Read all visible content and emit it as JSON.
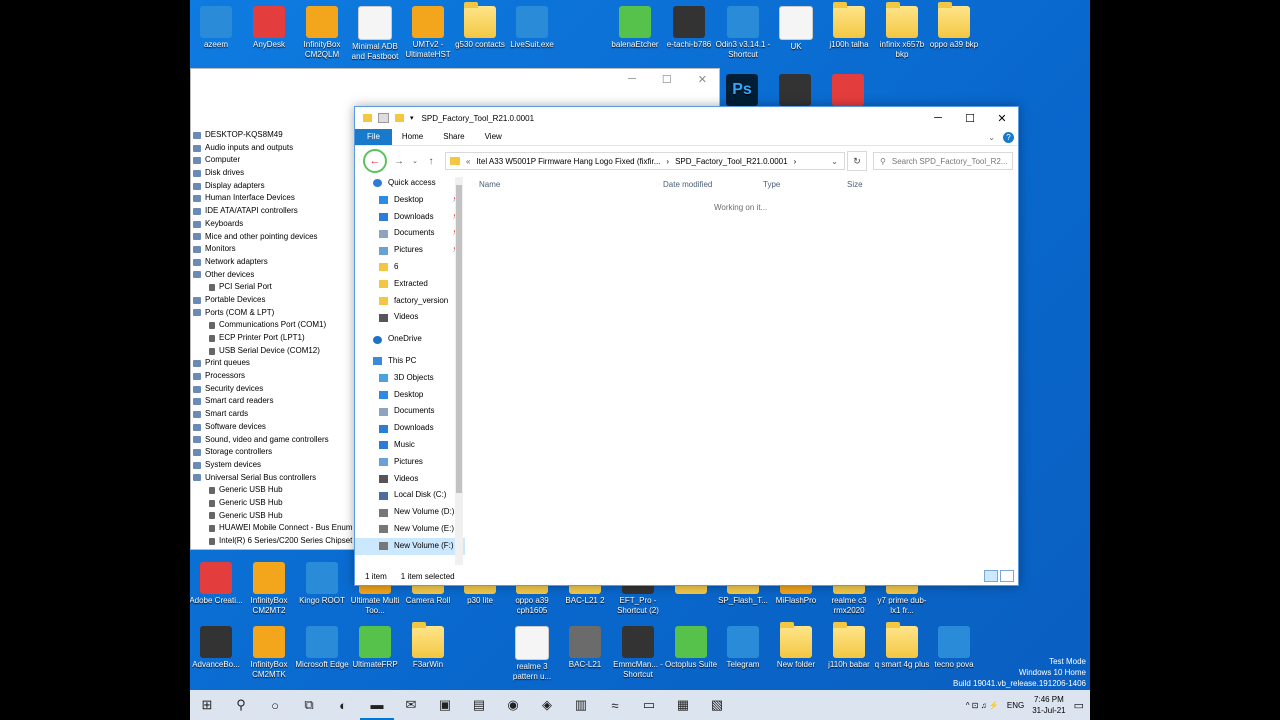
{
  "desktop": {
    "top_icons": [
      {
        "label": "azeem",
        "style": "app-blue"
      },
      {
        "label": "AnyDesk",
        "style": "app-red"
      },
      {
        "label": "InfinityBox CM2QLM",
        "style": "app-orange"
      },
      {
        "label": "Minimal ADB and Fastboot",
        "style": "app-white"
      },
      {
        "label": "UMTv2 - UltimateHST",
        "style": "app-orange"
      },
      {
        "label": "g530 contacts",
        "style": "folder"
      },
      {
        "label": "LiveSuit.exe",
        "style": "app-blue"
      },
      {
        "label": "balenaEtcher",
        "style": "app-green"
      },
      {
        "label": "e-tachi-b786",
        "style": "app-dark"
      },
      {
        "label": "Odin3 v3.14.1 - Shortcut",
        "style": "app-blue"
      },
      {
        "label": "UK",
        "style": "app-white"
      },
      {
        "label": "j100h talha",
        "style": "folder"
      },
      {
        "label": "infinix x657b bkp",
        "style": "folder"
      },
      {
        "label": "oppo a39 bkp",
        "style": "folder"
      }
    ],
    "second_row_icons": [
      {
        "label": "Ps",
        "style": "app-ps"
      },
      {
        "label": "",
        "style": "app-dark"
      },
      {
        "label": "",
        "style": "app-red"
      }
    ],
    "bottom_row1_icons": [
      {
        "label": "Adobe Creati...",
        "style": "app-red"
      },
      {
        "label": "InfinityBox CM2MT2",
        "style": "app-orange"
      },
      {
        "label": "Kingo ROOT",
        "style": "app-blue"
      },
      {
        "label": "Ultimate Multi Too...",
        "style": "app-orange"
      },
      {
        "label": "Camera Roll",
        "style": "folder"
      },
      {
        "label": "p30 lite",
        "style": "folder"
      },
      {
        "label": "oppo a39 cph1605",
        "style": "folder"
      },
      {
        "label": "BAC-L21 2",
        "style": "folder"
      },
      {
        "label": "EFT_Pro - Shortcut (2)",
        "style": "app-dark"
      },
      {
        "label": "",
        "style": "folder"
      },
      {
        "label": "SP_Flash_T...",
        "style": "folder"
      },
      {
        "label": "MiFlashPro",
        "style": "app-orange"
      },
      {
        "label": "realme c3 rmx2020",
        "style": "folder"
      },
      {
        "label": "y7 prime dub-lx1 fr...",
        "style": "folder"
      }
    ],
    "bottom_row2_icons": [
      {
        "label": "AdvanceBo...",
        "style": "app-dark"
      },
      {
        "label": "InfinityBox CM2MTK",
        "style": "app-orange"
      },
      {
        "label": "Microsoft Edge",
        "style": "app-blue"
      },
      {
        "label": "UltimateFRP",
        "style": "app-green"
      },
      {
        "label": "F3arWin",
        "style": "folder"
      },
      {
        "label": "realme 3 pattern u...",
        "style": "app-white"
      },
      {
        "label": "BAC-L21",
        "style": "app-gray"
      },
      {
        "label": "EmmcMan... - Shortcut",
        "style": "app-dark"
      },
      {
        "label": "Octoplus Suite",
        "style": "app-green"
      },
      {
        "label": "Telegram",
        "style": "app-blue"
      },
      {
        "label": "New folder",
        "style": "folder"
      },
      {
        "label": "j110h babar",
        "style": "folder"
      },
      {
        "label": "q smart 4g plus",
        "style": "folder"
      },
      {
        "label": "tecno pova",
        "style": "app-blue"
      }
    ]
  },
  "device_manager": {
    "window_controls": [
      "─",
      "☐",
      "✕"
    ],
    "items": [
      {
        "label": "DESKTOP-KQS8M49",
        "level": 0
      },
      {
        "label": "Audio inputs and outputs",
        "level": 0
      },
      {
        "label": "Computer",
        "level": 0
      },
      {
        "label": "Disk drives",
        "level": 0
      },
      {
        "label": "Display adapters",
        "level": 0
      },
      {
        "label": "Human Interface Devices",
        "level": 0
      },
      {
        "label": "IDE ATA/ATAPI controllers",
        "level": 0
      },
      {
        "label": "Keyboards",
        "level": 0
      },
      {
        "label": "Mice and other pointing devices",
        "level": 0
      },
      {
        "label": "Monitors",
        "level": 0
      },
      {
        "label": "Network adapters",
        "level": 0
      },
      {
        "label": "Other devices",
        "level": 0
      },
      {
        "label": "PCI Serial Port",
        "level": 1
      },
      {
        "label": "Portable Devices",
        "level": 0
      },
      {
        "label": "Ports (COM & LPT)",
        "level": 0
      },
      {
        "label": "Communications Port (COM1)",
        "level": 1
      },
      {
        "label": "ECP Printer Port (LPT1)",
        "level": 1
      },
      {
        "label": "USB Serial Device (COM12)",
        "level": 1
      },
      {
        "label": "Print queues",
        "level": 0
      },
      {
        "label": "Processors",
        "level": 0
      },
      {
        "label": "Security devices",
        "level": 0
      },
      {
        "label": "Smart card readers",
        "level": 0
      },
      {
        "label": "Smart cards",
        "level": 0
      },
      {
        "label": "Software devices",
        "level": 0
      },
      {
        "label": "Sound, video and game controllers",
        "level": 0
      },
      {
        "label": "Storage controllers",
        "level": 0
      },
      {
        "label": "System devices",
        "level": 0
      },
      {
        "label": "Universal Serial Bus controllers",
        "level": 0
      },
      {
        "label": "Generic USB Hub",
        "level": 1
      },
      {
        "label": "Generic USB Hub",
        "level": 1
      },
      {
        "label": "Generic USB Hub",
        "level": 1
      },
      {
        "label": "HUAWEI Mobile Connect - Bus Enum",
        "level": 1
      },
      {
        "label": "Intel(R) 6 Series/C200 Series Chipset",
        "level": 1
      }
    ]
  },
  "explorer": {
    "title": "SPD_Factory_Tool_R21.0.0001",
    "window_controls": [
      "─",
      "☐",
      "✕"
    ],
    "ribbon_tabs": [
      "File",
      "Home",
      "Share",
      "View"
    ],
    "address": {
      "prefix": "«",
      "crumb1": "Itel A33 W5001P Firmware Hang Logo Fixed  (fixfir...",
      "sep": "›",
      "crumb2": "SPD_Factory_Tool_R21.0.0001",
      "sep2": "›"
    },
    "search_placeholder": "Search SPD_Factory_Tool_R2...",
    "nav": [
      {
        "label": "Quick access",
        "type": "top",
        "icon": "star-icon",
        "color": "#2f7ad6"
      },
      {
        "label": "Desktop",
        "type": "sub",
        "icon": "desktop-icon",
        "color": "#2b8ce6",
        "pin": true
      },
      {
        "label": "Downloads",
        "type": "sub",
        "icon": "downloads-icon",
        "color": "#2b7ed8",
        "pin": true
      },
      {
        "label": "Documents",
        "type": "sub",
        "icon": "documents-icon",
        "color": "#8da3c0",
        "pin": true
      },
      {
        "label": "Pictures",
        "type": "sub",
        "icon": "pictures-icon",
        "color": "#6aa0d6",
        "pin": true
      },
      {
        "label": "6",
        "type": "sub",
        "icon": "folder-icon",
        "color": "#f3c742"
      },
      {
        "label": "Extracted",
        "type": "sub",
        "icon": "folder-icon",
        "color": "#f3c742"
      },
      {
        "label": "factory_version",
        "type": "sub",
        "icon": "folder-icon",
        "color": "#f3c742"
      },
      {
        "label": "Videos",
        "type": "sub",
        "icon": "videos-icon",
        "color": "#555"
      },
      {
        "label": "OneDrive",
        "type": "top",
        "icon": "onedrive-icon",
        "color": "#1f72c9",
        "gap": true
      },
      {
        "label": "This PC",
        "type": "top",
        "icon": "this-pc-icon",
        "color": "#3b8ad8",
        "gap": true
      },
      {
        "label": "3D Objects",
        "type": "sub",
        "icon": "3d-objects-icon",
        "color": "#4aa3e0"
      },
      {
        "label": "Desktop",
        "type": "sub",
        "icon": "desktop-icon",
        "color": "#2b8ce6"
      },
      {
        "label": "Documents",
        "type": "sub",
        "icon": "documents-icon",
        "color": "#8da3c0"
      },
      {
        "label": "Downloads",
        "type": "sub",
        "icon": "downloads-icon",
        "color": "#2b7ed8"
      },
      {
        "label": "Music",
        "type": "sub",
        "icon": "music-icon",
        "color": "#2b7ed8"
      },
      {
        "label": "Pictures",
        "type": "sub",
        "icon": "pictures-icon",
        "color": "#6aa0d6"
      },
      {
        "label": "Videos",
        "type": "sub",
        "icon": "videos-icon",
        "color": "#555"
      },
      {
        "label": "Local Disk (C:)",
        "type": "sub",
        "icon": "drive-icon",
        "color": "#4a6f9e"
      },
      {
        "label": "New Volume (D:)",
        "type": "sub",
        "icon": "drive-icon",
        "color": "#777"
      },
      {
        "label": "New Volume (E:)",
        "type": "sub",
        "icon": "drive-icon",
        "color": "#777"
      },
      {
        "label": "New Volume (F:)",
        "type": "sub",
        "icon": "drive-icon",
        "color": "#777",
        "selected": true
      }
    ],
    "columns": [
      "Name",
      "Date modified",
      "Type",
      "Size"
    ],
    "working_text": "Working on it...",
    "status_items": "1 item",
    "status_selected": "1 item selected"
  },
  "watermark": {
    "line1": "Test Mode",
    "line2": "Windows 10 Home",
    "line3": "Build 19041.vb_release.191206-1406"
  },
  "taskbar": {
    "buttons": [
      {
        "name": "start-button",
        "glyph": "⊞"
      },
      {
        "name": "search-button",
        "glyph": "⚲"
      },
      {
        "name": "cortana-button",
        "glyph": "○"
      },
      {
        "name": "task-view-button",
        "glyph": "⧉"
      },
      {
        "name": "edge-taskbar-button",
        "glyph": "◐"
      },
      {
        "name": "file-explorer-taskbar-button",
        "glyph": "▬",
        "active": true
      },
      {
        "name": "mail-taskbar-button",
        "glyph": "✉"
      },
      {
        "name": "store-taskbar-button",
        "glyph": "▣"
      },
      {
        "name": "app-taskbar-button",
        "glyph": "▤"
      },
      {
        "name": "chrome-taskbar-button",
        "glyph": "◉"
      },
      {
        "name": "app2-taskbar-button",
        "glyph": "◈"
      },
      {
        "name": "app3-taskbar-button",
        "glyph": "▥"
      },
      {
        "name": "app4-taskbar-button",
        "glyph": "≈"
      },
      {
        "name": "cmd-taskbar-button",
        "glyph": "▭"
      },
      {
        "name": "app5-taskbar-button",
        "glyph": "▦"
      },
      {
        "name": "app6-taskbar-button",
        "glyph": "▧"
      }
    ],
    "tray_glyphs": "^  ⊡  ♫  ⚡",
    "language": "ENG",
    "time": "7:46 PM",
    "date": "31-Jul-21"
  }
}
